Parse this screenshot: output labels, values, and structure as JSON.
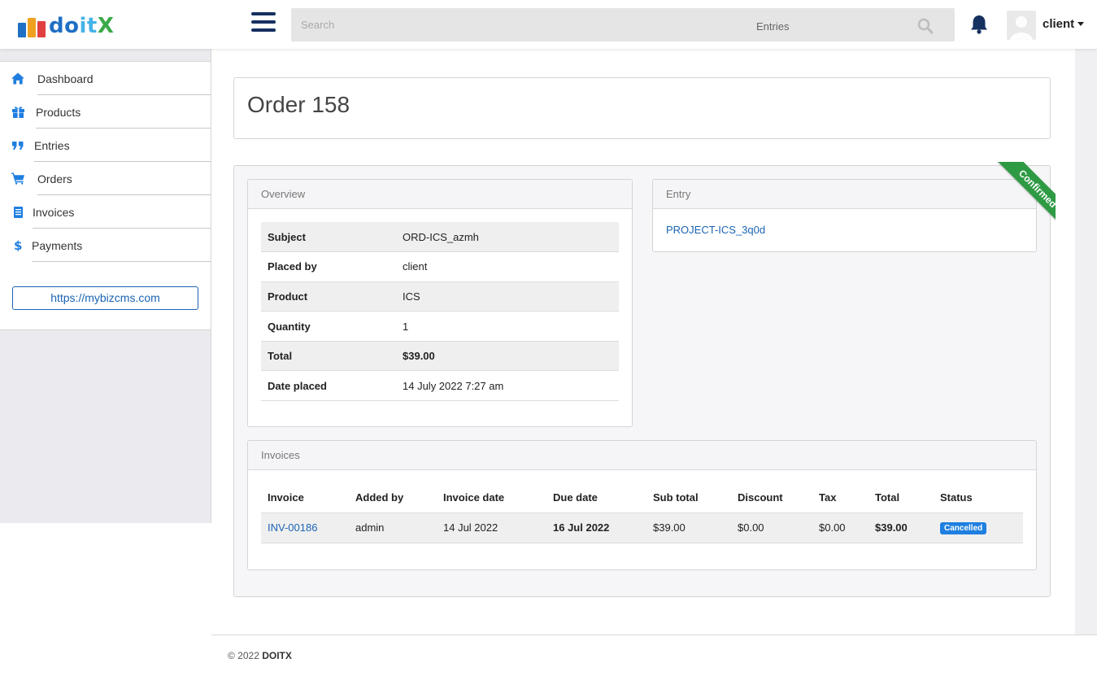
{
  "brand": {
    "logo_text_1": "do",
    "logo_text_2": "it",
    "logo_text_3": "X",
    "block_colors": [
      "#1f6fc5",
      "#f0a020",
      "#e04040",
      "#3aa948"
    ]
  },
  "header": {
    "search_placeholder": "Search",
    "search_scope": "Entries",
    "user_name": "client"
  },
  "sidebar": {
    "items": [
      {
        "label": "Dashboard",
        "icon": "home-icon"
      },
      {
        "label": "Products",
        "icon": "gift-icon"
      },
      {
        "label": "Entries",
        "icon": "quote-icon"
      },
      {
        "label": "Orders",
        "icon": "cart-icon"
      },
      {
        "label": "Invoices",
        "icon": "document-icon"
      },
      {
        "label": "Payments",
        "icon": "dollar-icon"
      }
    ],
    "site_link": "https://mybizcms.com"
  },
  "page": {
    "title": "Order 158"
  },
  "overview": {
    "heading": "Overview",
    "rows": [
      {
        "key": "Subject",
        "value": "ORD-ICS_azmh"
      },
      {
        "key": "Placed by",
        "value": "client"
      },
      {
        "key": "Product",
        "value": "ICS"
      },
      {
        "key": "Quantity",
        "value": "1"
      },
      {
        "key": "Total",
        "value": "$39.00"
      },
      {
        "key": "Date placed",
        "value": "14 July 2022 7:27 am"
      }
    ]
  },
  "entry": {
    "heading": "Entry",
    "link": "PROJECT-ICS_3q0d",
    "ribbon": "Confirmed",
    "ribbon_color": "#2e9a44"
  },
  "invoices": {
    "heading": "Invoices",
    "columns": [
      "Invoice",
      "Added by",
      "Invoice date",
      "Due date",
      "Sub total",
      "Discount",
      "Tax",
      "Total",
      "Status"
    ],
    "rows": [
      {
        "invoice": "INV-00186",
        "added_by": "admin",
        "invoice_date": "14 Jul 2022",
        "due_date": "16 Jul 2022",
        "sub_total": "$39.00",
        "discount": "$0.00",
        "tax": "$0.00",
        "total": "$39.00",
        "status": "Cancelled"
      }
    ]
  },
  "footer": {
    "copyright": "© 2022",
    "brand": "DOITX"
  },
  "colors": {
    "accent": "#1a64b4",
    "nav_icon": "#1f7fe0",
    "due_date": "#c02a2a",
    "status_badge": "#1f7fe0"
  }
}
